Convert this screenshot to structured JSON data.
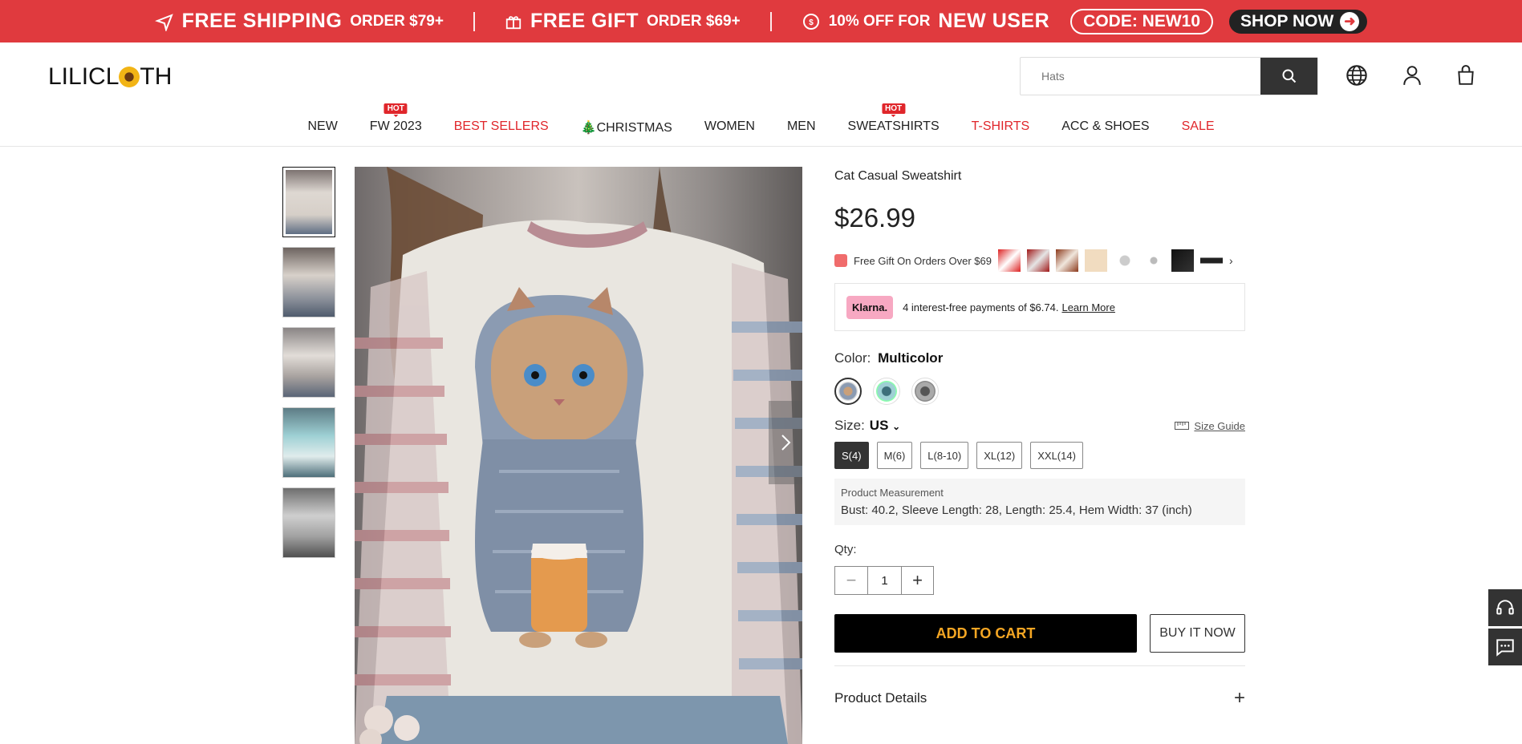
{
  "promo": {
    "shipping_big": "FREE SHIPPING",
    "shipping_small": "ORDER $79+",
    "gift_big": "FREE GIFT",
    "gift_small": "ORDER $69+",
    "discount_small": "10% OFF FOR",
    "discount_big": "NEW USER",
    "code": "CODE: NEW10",
    "shop_now": "SHOP NOW"
  },
  "header": {
    "logo_pre": "LILICL",
    "logo_post": "TH",
    "search_placeholder": "Hats"
  },
  "nav": [
    {
      "label": "NEW",
      "red": false,
      "hot": ""
    },
    {
      "label": "FW 2023",
      "red": false,
      "hot": "HOT"
    },
    {
      "label": "BEST SELLERS",
      "red": true,
      "hot": ""
    },
    {
      "label": "🎄CHRISTMAS",
      "red": false,
      "hot": ""
    },
    {
      "label": "WOMEN",
      "red": false,
      "hot": ""
    },
    {
      "label": "MEN",
      "red": false,
      "hot": ""
    },
    {
      "label": "SWEATSHIRTS",
      "red": false,
      "hot": "HOT"
    },
    {
      "label": "T-SHIRTS",
      "red": true,
      "hot": ""
    },
    {
      "label": "ACC & SHOES",
      "red": false,
      "hot": ""
    },
    {
      "label": "SALE",
      "red": true,
      "hot": ""
    }
  ],
  "product": {
    "title": "Cat Casual Sweatshirt",
    "price": "$26.99",
    "gift_text": "Free Gift On Orders Over $69",
    "klarna_badge": "Klarna.",
    "klarna_text": "4 interest-free payments of $6.74.",
    "klarna_link": "Learn More",
    "color_label": "Color:",
    "color_value": "Multicolor",
    "size_label": "Size:",
    "size_region": "US",
    "size_guide": "Size Guide",
    "sizes": [
      "S(4)",
      "M(6)",
      "L(8-10)",
      "XL(12)",
      "XXL(14)"
    ],
    "selected_size": "S(4)",
    "measure_title": "Product Measurement",
    "measure_text": "Bust: 40.2, Sleeve Length: 28, Length: 25.4, Hem Width: 37 (inch)",
    "qty_label": "Qty:",
    "qty_value": "1",
    "add_to_cart": "ADD TO CART",
    "buy_now": "BUY IT NOW",
    "details": "Product Details"
  },
  "colors": {
    "promo_bg": "#e03a3e",
    "accent_red": "#e0262b",
    "add_text": "#f5a623"
  }
}
